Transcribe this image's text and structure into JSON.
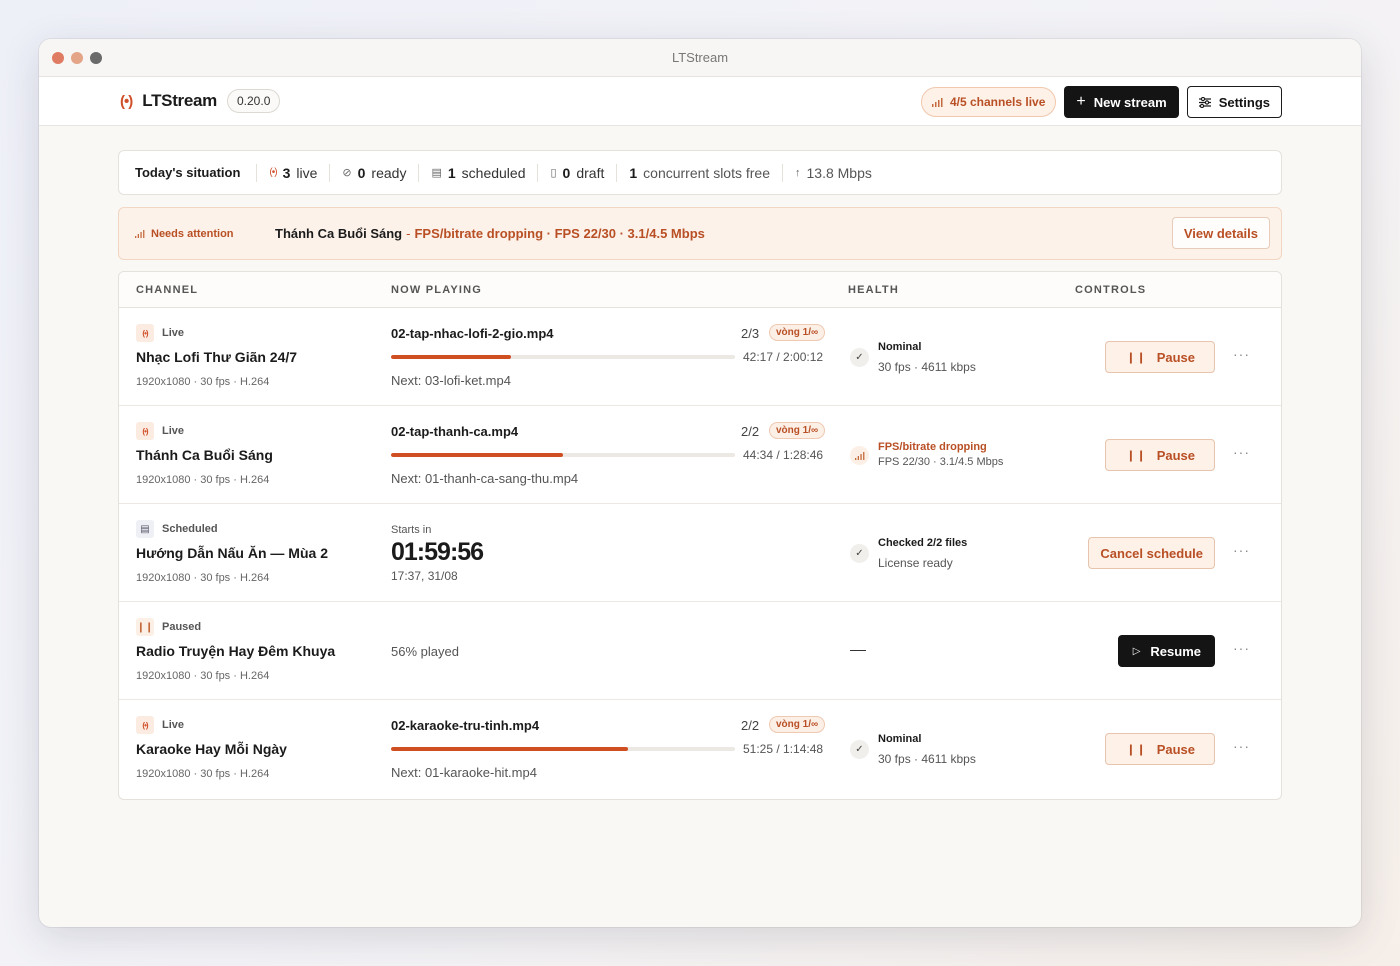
{
  "window": {
    "title": "LTStream"
  },
  "app": {
    "name": "LTStream",
    "version": "0.20.0",
    "live_pill": "4/5 channels live",
    "new_stream": "New stream",
    "settings": "Settings"
  },
  "situation": {
    "title": "Today's situation",
    "live_count": "3",
    "live_label": "live",
    "ready_count": "0",
    "ready_label": "ready",
    "scheduled_count": "1",
    "scheduled_label": "scheduled",
    "draft_count": "0",
    "draft_label": "draft",
    "slots_count": "1",
    "slots_label": "concurrent slots free",
    "bandwidth": "13.8 Mbps"
  },
  "attention": {
    "label": "Needs attention",
    "channel": "Thánh Ca Buổi Sáng",
    "separator": "-",
    "detail": "FPS/bitrate dropping · FPS 22/30 · 3.1/4.5 Mbps",
    "button": "View details"
  },
  "table": {
    "headers": [
      "CHANNEL",
      "NOW PLAYING",
      "HEALTH",
      "CONTROLS"
    ],
    "rows": [
      {
        "status": "Live",
        "name": "Nhạc Lofi Thư Giãn 24/7",
        "spec": "1920x1080 · 30 fps · H.264",
        "file": "02-tap-nhac-lofi-2-gio.mp4",
        "count": "2/3",
        "loop": "vòng 1/∞",
        "progress": 0.35,
        "time": "42:17 / 2:00:12",
        "next": "Next: 03-lofi-ket.mp4",
        "health_title": "Nominal",
        "health_sub": "30 fps · 4611 kbps",
        "control": "Pause"
      },
      {
        "status": "Live",
        "name": "Thánh Ca Buổi Sáng",
        "spec": "1920x1080 · 30 fps · H.264",
        "file": "02-tap-thanh-ca.mp4",
        "count": "2/2",
        "loop": "vòng 1/∞",
        "progress": 0.5,
        "time": "44:34 / 1:28:46",
        "next": "Next: 01-thanh-ca-sang-thu.mp4",
        "health_title": "FPS/bitrate dropping",
        "health_sub": "FPS 22/30 · 3.1/4.5 Mbps",
        "control": "Pause"
      },
      {
        "status": "Scheduled",
        "name": "Hướng Dẫn Nấu Ăn — Mùa 2",
        "spec": "1920x1080 · 30 fps · H.264",
        "starts_label": "Starts in",
        "countdown": "01:59:56",
        "date": "17:37, 31/08",
        "health_title": "Checked 2/2 files",
        "health_sub": "License ready",
        "control": "Cancel schedule"
      },
      {
        "status": "Paused",
        "name": "Radio Truyện Hay Đêm Khuya",
        "spec": "1920x1080 · 30 fps · H.264",
        "played": "56% played",
        "control": "Resume"
      },
      {
        "status": "Live",
        "name": "Karaoke Hay Mỗi Ngày",
        "spec": "1920x1080 · 30 fps · H.264",
        "file": "02-karaoke-tru-tinh.mp4",
        "count": "2/2",
        "loop": "vòng 1/∞",
        "progress": 0.69,
        "time": "51:25 / 1:14:48",
        "next": "Next: 01-karaoke-hit.mp4",
        "health_title": "Nominal",
        "health_sub": "30 fps · 4611 kbps",
        "control": "Pause"
      }
    ]
  },
  "colors": {
    "accent": "#cf4e22",
    "accent_text": "#b94f24",
    "dark": "#141414"
  },
  "icons": {
    "broadcast": "broadcast-icon",
    "signal": "signal-bars-icon",
    "check": "check-circle-icon",
    "calendar": "calendar-icon",
    "draft": "draft-file-icon",
    "upload": "arrow-up-icon",
    "pause": "pause-icon",
    "play": "play-icon",
    "plus": "plus-icon",
    "sliders": "sliders-icon",
    "more": "more-dots-icon"
  }
}
